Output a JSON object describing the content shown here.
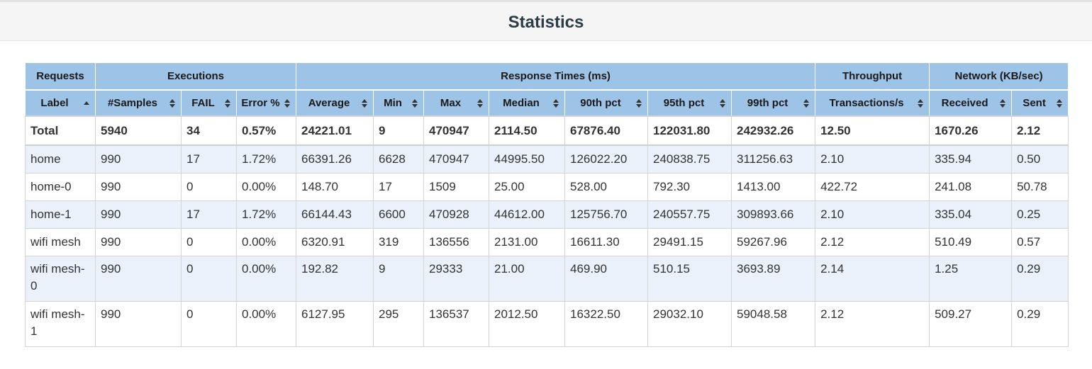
{
  "page": {
    "title": "Statistics"
  },
  "groups": {
    "requests": "Requests",
    "executions": "Executions",
    "response_times": "Response Times (ms)",
    "throughput": "Throughput",
    "network": "Network (KB/sec)"
  },
  "columns": [
    "Label",
    "#Samples",
    "FAIL",
    "Error %",
    "Average",
    "Min",
    "Max",
    "Median",
    "90th pct",
    "95th pct",
    "99th pct",
    "Transactions/s",
    "Received",
    "Sent"
  ],
  "sort": {
    "column": "Label",
    "direction": "ascending"
  },
  "total": [
    "Total",
    "5940",
    "34",
    "0.57%",
    "24221.01",
    "9",
    "470947",
    "2114.50",
    "67876.40",
    "122031.80",
    "242932.26",
    "12.50",
    "1670.26",
    "2.12"
  ],
  "rows": [
    [
      "home",
      "990",
      "17",
      "1.72%",
      "66391.26",
      "6628",
      "470947",
      "44995.50",
      "126022.20",
      "240838.75",
      "311256.63",
      "2.10",
      "335.94",
      "0.50"
    ],
    [
      "home-0",
      "990",
      "0",
      "0.00%",
      "148.70",
      "17",
      "1509",
      "25.00",
      "528.00",
      "792.30",
      "1413.00",
      "422.72",
      "241.08",
      "50.78"
    ],
    [
      "home-1",
      "990",
      "17",
      "1.72%",
      "66144.43",
      "6600",
      "470928",
      "44612.00",
      "125756.70",
      "240557.75",
      "309893.66",
      "2.10",
      "335.04",
      "0.25"
    ],
    [
      "wifi mesh",
      "990",
      "0",
      "0.00%",
      "6320.91",
      "319",
      "136556",
      "2131.00",
      "16611.30",
      "29491.15",
      "59267.96",
      "2.12",
      "510.49",
      "0.57"
    ],
    [
      "wifi mesh-0",
      "990",
      "0",
      "0.00%",
      "192.82",
      "9",
      "29333",
      "21.00",
      "469.90",
      "510.15",
      "3693.89",
      "2.14",
      "1.25",
      "0.29"
    ],
    [
      "wifi mesh-1",
      "990",
      "0",
      "0.00%",
      "6127.95",
      "295",
      "136537",
      "2012.50",
      "16322.50",
      "29032.10",
      "59048.58",
      "2.12",
      "509.27",
      "0.29"
    ]
  ],
  "colors": {
    "header_bg": "#9dc3e6",
    "row_alt": "#eaf1fb",
    "title": "#2b3d47"
  }
}
